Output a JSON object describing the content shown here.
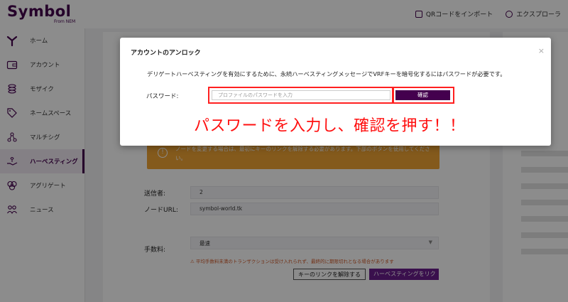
{
  "app": {
    "logo_text": "Symbol",
    "logo_sub": "From NEM"
  },
  "topbar": {
    "qr_import": "QRコードをインポート",
    "explorer": "エクスプローラ"
  },
  "sidebar": {
    "items": [
      {
        "label": "ホーム",
        "icon": "symbol-logo-icon"
      },
      {
        "label": "アカウント",
        "icon": "wallet-icon"
      },
      {
        "label": "モザイク",
        "icon": "coins-icon"
      },
      {
        "label": "ネームスペース",
        "icon": "tag-icon"
      },
      {
        "label": "マルチシグ",
        "icon": "multisig-icon"
      },
      {
        "label": "ハーベスティング",
        "icon": "harvest-hand-icon"
      },
      {
        "label": "アグリゲート",
        "icon": "aggregate-icon"
      },
      {
        "label": "ニュース",
        "icon": "news-icon"
      }
    ],
    "active_index": 5
  },
  "background_form": {
    "warning": "ノードを変更する場合は、最初にキーのリンクを解除する必要があります。下部のボタンを使用してください。",
    "sender_label": "送信者:",
    "sender_value": "2",
    "node_url_label": "ノードURL:",
    "node_url_value": "symbol-world.tk",
    "fee_label": "手数料:",
    "fee_value": "最速",
    "fee_warning": "平均手数料未満のトランザクションは受け入れられず、最終的に期限切れとなる場合があります",
    "unlink_button": "キーのリンクを解除する",
    "harvest_button": "ハーベスティングをリク"
  },
  "modal": {
    "title": "アカウントのアンロック",
    "close": "×",
    "description": "デリゲートハーベスティングを有効にするために、永続ハーベスティングメッセージでVRFキーを暗号化するにはパスワードが必要です。",
    "password_label": "パスワード:",
    "password_placeholder": "プロファイルのパスワードを入力",
    "password_value": "",
    "confirm_button": "確認",
    "annotation": "パスワードを入力し、確認を押す！！"
  },
  "colors": {
    "brand": "#44004e",
    "highlight": "#ff2020",
    "warning": "#f0a434",
    "accent_purple": "#6b1e8d"
  }
}
